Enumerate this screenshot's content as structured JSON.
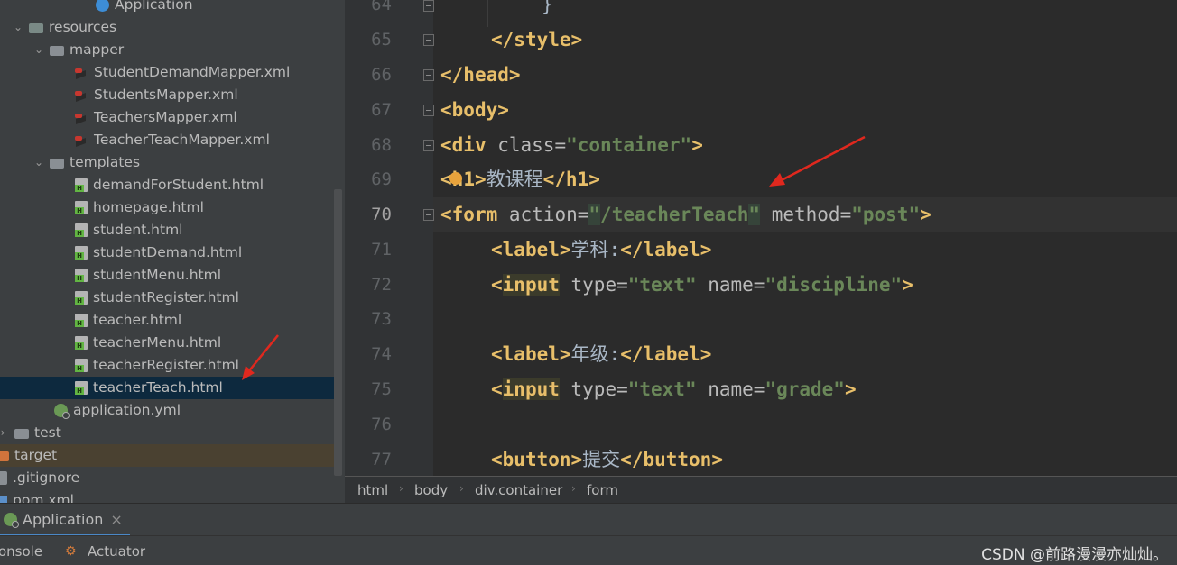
{
  "project_tree": {
    "items": [
      {
        "label": "Application",
        "icon": "app-icon"
      },
      {
        "label": "resources",
        "icon": "folder-icon"
      },
      {
        "label": "mapper",
        "icon": "folder-icon"
      },
      {
        "label": "StudentDemandMapper.xml",
        "icon": "xml-file-icon"
      },
      {
        "label": "StudentsMapper.xml",
        "icon": "xml-file-icon"
      },
      {
        "label": "TeachersMapper.xml",
        "icon": "xml-file-icon"
      },
      {
        "label": "TeacherTeachMapper.xml",
        "icon": "xml-file-icon"
      },
      {
        "label": "templates",
        "icon": "folder-icon"
      },
      {
        "label": "demandForStudent.html",
        "icon": "html-file-icon"
      },
      {
        "label": "homepage.html",
        "icon": "html-file-icon"
      },
      {
        "label": "student.html",
        "icon": "html-file-icon"
      },
      {
        "label": "studentDemand.html",
        "icon": "html-file-icon"
      },
      {
        "label": "studentMenu.html",
        "icon": "html-file-icon"
      },
      {
        "label": "studentRegister.html",
        "icon": "html-file-icon"
      },
      {
        "label": "teacher.html",
        "icon": "html-file-icon"
      },
      {
        "label": "teacherMenu.html",
        "icon": "html-file-icon"
      },
      {
        "label": "teacherRegister.html",
        "icon": "html-file-icon"
      },
      {
        "label": "teacherTeach.html",
        "icon": "html-file-icon",
        "selected": true
      },
      {
        "label": "application.yml",
        "icon": "spring-config-icon"
      },
      {
        "label": "test",
        "icon": "folder-icon"
      },
      {
        "label": "target",
        "icon": "folder-icon"
      },
      {
        "label": ".gitignore",
        "icon": "gitignore-file-icon"
      },
      {
        "label": "pom.xml",
        "icon": "maven-file-icon"
      }
    ]
  },
  "editor": {
    "line_numbers": [
      "64",
      "65",
      "66",
      "67",
      "68",
      "69",
      "70",
      "71",
      "72",
      "73",
      "74",
      "75",
      "76",
      "77"
    ],
    "current_line": "70",
    "lines": {
      "l64": {
        "brace": "}"
      },
      "l65": {
        "open": "</",
        "tag": "style",
        "close": ">"
      },
      "l66": {
        "open": "</",
        "tag": "head",
        "close": ">"
      },
      "l67": {
        "open": "<",
        "tag": "body",
        "close": ">"
      },
      "l68": {
        "open": "<",
        "tag": "div",
        "attr": " class=",
        "value": "\"container\"",
        "close": ">"
      },
      "l69": {
        "open": "<",
        "tag_a": "h",
        "tag_b": "1",
        "close": ">",
        "text": "教课程",
        "end_open": "</",
        "end_tag": "h1",
        "end_close": ">"
      },
      "l70": {
        "open": "<",
        "tag": "form",
        "attr1": " action=",
        "q1": "\"",
        "value1": "/teacherTeach",
        "q2": "\"",
        "attr2": " method=",
        "value2": "\"post\"",
        "close": ">"
      },
      "l71": {
        "open": "<",
        "tag": "label",
        "close": ">",
        "text": "学科:",
        "end_open": "</",
        "end_tag": "label",
        "end_close": ">"
      },
      "l72": {
        "open": "<",
        "tag": "input",
        "attr1": " type=",
        "value1": "\"text\"",
        "attr2": " name=",
        "value2": "\"discipline\"",
        "close": ">"
      },
      "l74": {
        "open": "<",
        "tag": "label",
        "close": ">",
        "text": "年级:",
        "end_open": "</",
        "end_tag": "label",
        "end_close": ">"
      },
      "l75": {
        "open": "<",
        "tag": "input",
        "attr1": " type=",
        "value1": "\"text\"",
        "attr2": " name=",
        "value2": "\"grade\"",
        "close": ">"
      },
      "l77": {
        "open": "<",
        "tag": "button",
        "close": ">",
        "text": "提交",
        "end_open": "</",
        "end_tag": "button",
        "end_close": ">"
      }
    }
  },
  "breadcrumb": [
    "html",
    "body",
    "div.container",
    "form"
  ],
  "run_panel": {
    "tab_label": "Application",
    "close_symbol": "×"
  },
  "bottom_tools": {
    "console": "onsole",
    "actuator": "Actuator"
  },
  "watermark": "CSDN @前路漫漫亦灿灿。",
  "colors": {
    "tag": "#e8bf6a",
    "string": "#6a8759",
    "selection": "#0d293e",
    "annotation_arrow": "#e0281e"
  }
}
